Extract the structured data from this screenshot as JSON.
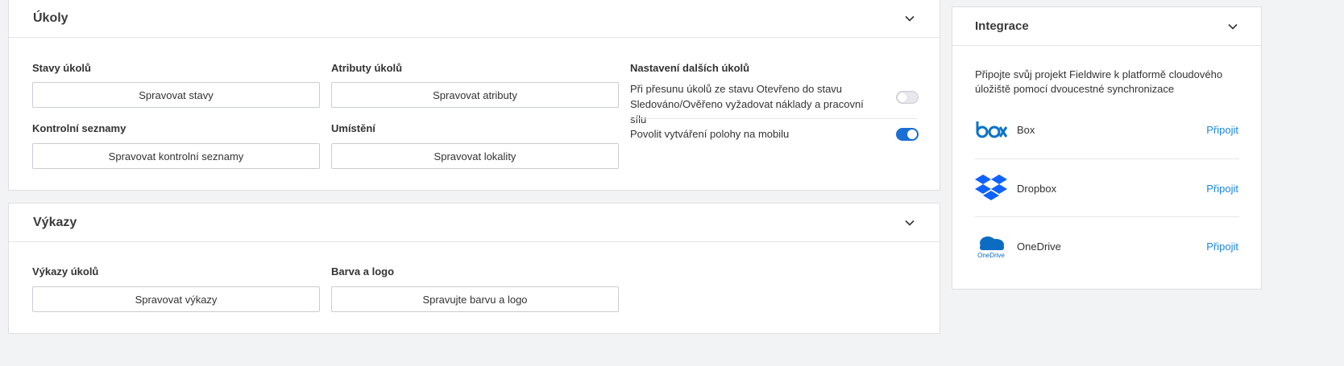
{
  "tasks": {
    "title": "Úkoly",
    "states_label": "Stavy úkolů",
    "states_button": "Spravovat stavy",
    "attributes_label": "Atributy úkolů",
    "attributes_button": "Spravovat atributy",
    "checklists_label": "Kontrolní seznamy",
    "checklists_button": "Spravovat kontrolní seznamy",
    "location_label": "Umístění",
    "location_button": "Spravovat lokality",
    "more_settings_label": "Nastavení dalších úkolů",
    "setting1_line1": "Při přesunu úkolů ze stavu Otevřeno do stavu",
    "setting1_line2": "Sledováno/Ověřeno vyžadovat náklady a pracovní sílu",
    "setting1_enabled": false,
    "setting2_text": "Povolit vytváření polohy na mobilu",
    "setting2_enabled": true
  },
  "reports": {
    "title": "Výkazy",
    "task_reports_label": "Výkazy úkolů",
    "task_reports_button": "Spravovat výkazy",
    "branding_label": "Barva a logo",
    "branding_button": "Spravujte barvu a logo"
  },
  "integrations": {
    "title": "Integrace",
    "description_line1": "Připojte svůj projekt Fieldwire k platformě cloudového",
    "description_line2": "úložiště pomocí dvoucestné synchronizace",
    "items": [
      {
        "name": "Box",
        "link": "Připojit",
        "icon": "box-logo"
      },
      {
        "name": "Dropbox",
        "link": "Připojit",
        "icon": "dropbox-logo"
      },
      {
        "name": "OneDrive",
        "link": "Připojit",
        "icon": "onedrive-logo",
        "logo_caption": "OneDrive"
      }
    ]
  },
  "colors": {
    "accent": "#1a6fd6",
    "link": "#1a86e0",
    "box_brand": "#0a73c8",
    "dropbox_brand": "#0f62fe",
    "onedrive_brand": "#0c6cc4"
  }
}
